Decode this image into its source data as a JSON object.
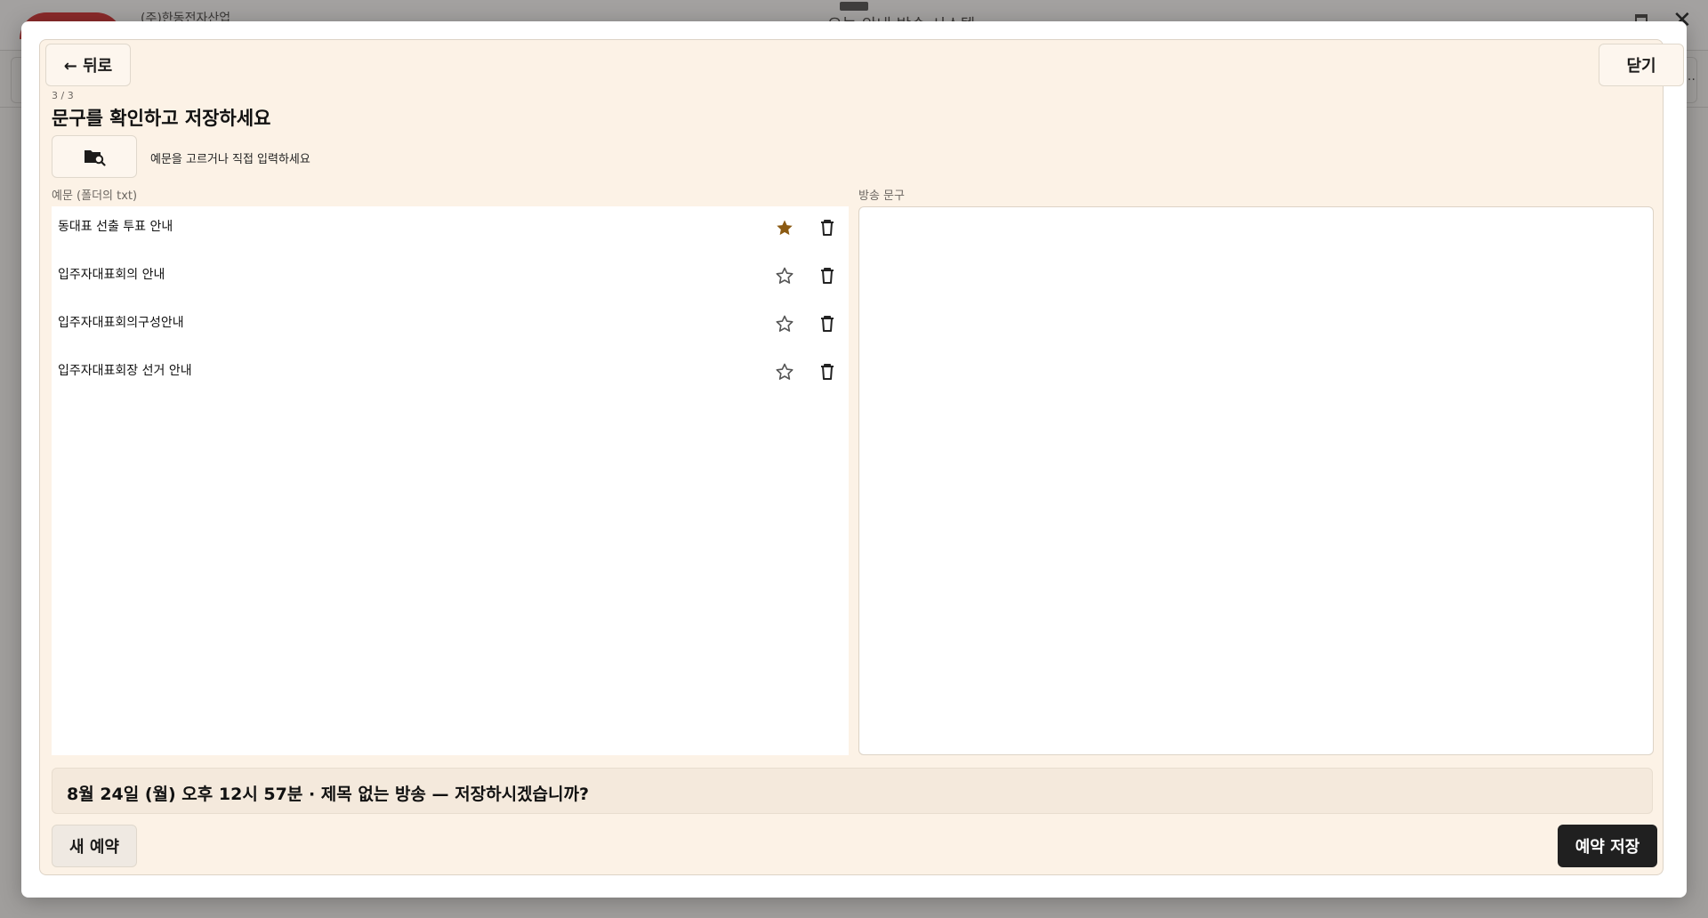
{
  "background": {
    "company": "(주)한동전자산업",
    "title": "오늘 안내 방송 시스템"
  },
  "modal": {
    "back_label": "← 뒤로",
    "close_label": "닫기",
    "step": "3 / 3",
    "heading": "문구를 확인하고 저장하세요",
    "folder_hint": "예문을 고르거나 직접 입력하세요",
    "examples_label": "예문 (폴더의 txt)",
    "broadcast_label": "방송 문구",
    "broadcast_text": "",
    "examples": [
      {
        "label": "동대표 선출 투표 안내",
        "favorite": true
      },
      {
        "label": "입주자대표회의 안내",
        "favorite": false
      },
      {
        "label": "입주자대표회의구성안내",
        "favorite": false
      },
      {
        "label": "입주자대표회장 선거 안내",
        "favorite": false
      }
    ],
    "confirm_text": "8월 24일 (월) 오후 12시 57분 · 제목 없는 방송 — 저장하시겠습니까?",
    "new_label": "새 예약",
    "save_label": "예약 저장"
  },
  "colors": {
    "panel": "#fcf2e6",
    "favorite_star": "#8b5a12",
    "save_button": "#202020"
  },
  "icons": {
    "folder": "folder-search-icon",
    "star": "star-icon",
    "trash": "trash-icon"
  }
}
